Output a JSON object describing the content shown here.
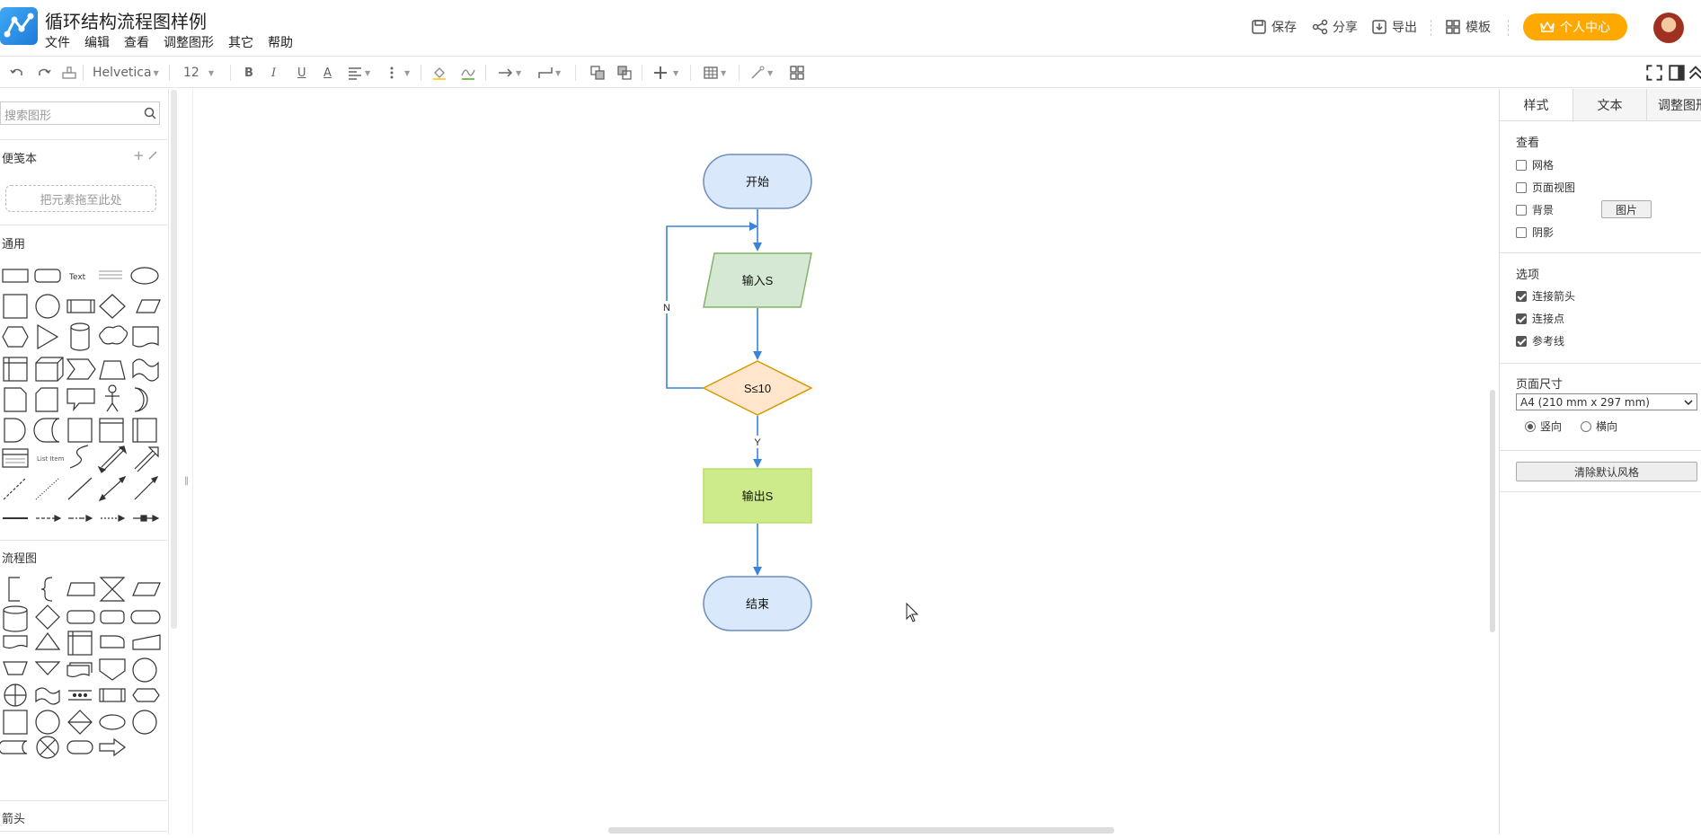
{
  "header": {
    "title": "循环结构流程图样例",
    "menu": [
      "文件",
      "编辑",
      "查看",
      "调整图形",
      "其它",
      "帮助"
    ],
    "actions": {
      "save": "保存",
      "share": "分享",
      "export": "导出",
      "template": "模板"
    },
    "personal_center": "个人中心",
    "accent_color": "#ffa800"
  },
  "toolbar": {
    "font": "Helvetica",
    "font_size": "12",
    "bold": "B",
    "italic": "I",
    "underline": "U",
    "font_color": "A"
  },
  "sidebar": {
    "search_placeholder": "搜索图形",
    "scratchpad_title": "便笺本",
    "scratchpad_add": "+",
    "dropzone": "把元素拖至此处",
    "general_title": "通用",
    "flowchart_title": "流程图",
    "arrows_title": "箭头",
    "shape_text": "Text",
    "shape_list_item": "List Item"
  },
  "diagram": {
    "start": "开始",
    "input": "输入S",
    "condition": "S≤10",
    "output": "输出S",
    "end": "结束",
    "label_no": "N",
    "label_yes": "Y",
    "colors": {
      "terminal_fill": "#dae8fc",
      "terminal_stroke": "#6c8ebf",
      "input_fill": "#d5e8d4",
      "input_stroke": "#82b366",
      "decision_fill": "#ffe6cc",
      "decision_stroke": "#d79b00",
      "output_fill": "#cdeb8b",
      "output_stroke": "#b8e06a",
      "edge": "#3b82d9"
    }
  },
  "right_panel": {
    "tabs": [
      "样式",
      "文本",
      "调整图形"
    ],
    "view_title": "查看",
    "view_options": [
      {
        "label": "网格",
        "checked": false
      },
      {
        "label": "页面视图",
        "checked": false
      },
      {
        "label": "背景",
        "checked": false
      },
      {
        "label": "阴影",
        "checked": false
      }
    ],
    "image_button": "图片",
    "options_title": "选项",
    "options": [
      {
        "label": "连接箭头",
        "checked": true
      },
      {
        "label": "连接点",
        "checked": true
      },
      {
        "label": "参考线",
        "checked": true
      }
    ],
    "page_size_title": "页面尺寸",
    "page_size_value": "A4 (210 mm x 297 mm)",
    "orientation": {
      "portrait": "竖向",
      "landscape": "横向",
      "selected": "portrait"
    },
    "clear_style_button": "清除默认风格"
  }
}
